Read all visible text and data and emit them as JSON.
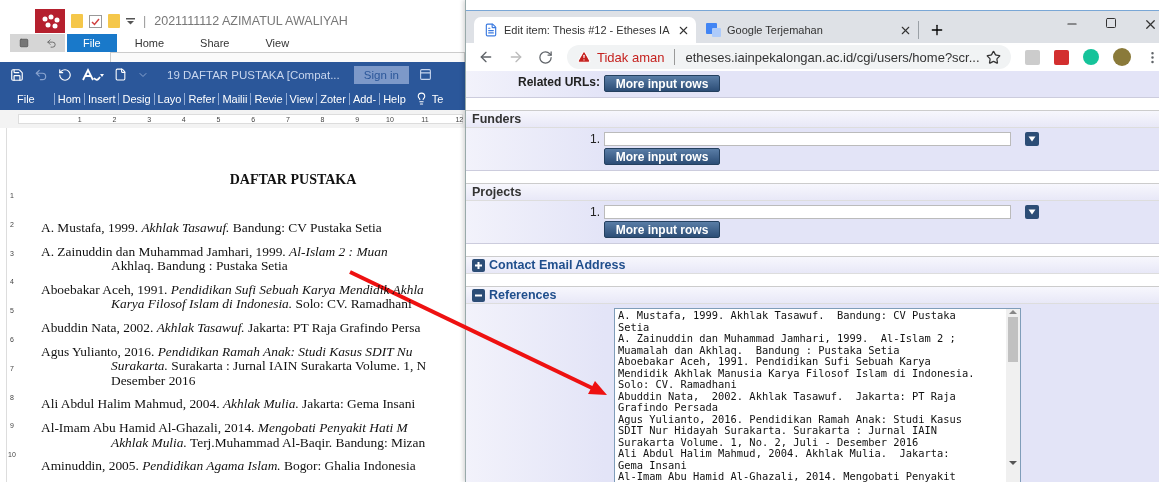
{
  "file_explorer": {
    "separator": "|",
    "title": "2021111112 AZIMATUL AWALIYAH",
    "tabs": [
      {
        "label": "File",
        "selected": true
      },
      {
        "label": "Home",
        "selected": false
      },
      {
        "label": "Share",
        "selected": false
      },
      {
        "label": "View",
        "selected": false
      }
    ]
  },
  "word": {
    "title": "19 DAFTAR PUSTAKA [Compat...",
    "sign_in": "Sign in",
    "tabs": [
      "File",
      "Hom",
      "Insert",
      "Desig",
      "Layo",
      "Refer",
      "Mailii",
      "Revie",
      "View",
      "Zoter",
      "Add-",
      "Help"
    ],
    "tell_me": "Te",
    "ruler_numbers": [
      "1",
      "2",
      "3",
      "4",
      "5",
      "6",
      "7",
      "8",
      "9",
      "10",
      "11",
      "12"
    ],
    "vertical_ruler_numbers": [
      "1",
      "2",
      "3",
      "4",
      "5",
      "6",
      "7",
      "8",
      "9",
      "10"
    ],
    "heading": "DAFTAR PUSTAKA",
    "entries": [
      {
        "lines": [
          "A. Mustafa, 1999. *Akhlak Tasawuf.*  Bandung: CV Pustaka Setia"
        ]
      },
      {
        "lines": [
          "A. Zainuddin dan Muhammad Jamhari, 1999.  *Al-Islam 2 : Muan*",
          "Akhlaq. Bandung : Pustaka Setia"
        ]
      },
      {
        "lines": [
          "Aboebakar Aceh, 1991. *Pendidikan Sufi Sebuah Karya Mendidik Akhla*",
          "*Karya Filosof Islam di Indonesia.*  Solo: CV. Ramadhani"
        ]
      },
      {
        "lines": [
          "Abuddin Nata, 2002. *Akhlak Tasawuf.*  Jakarta: PT Raja Grafindo Persa"
        ]
      },
      {
        "lines": [
          "Agus Yulianto, 2016. *Pendidikan Ramah Anak: Studi Kasus SDIT Nu*",
          "*Surakarta.* Surakarta : Jurnal IAIN Surakarta Volume. 1, N",
          "Desember 2016"
        ]
      },
      {
        "lines": [
          "Ali Abdul Halim Mahmud, 2004. *Akhlak Mulia.*  Jakarta: Gema Insani"
        ]
      },
      {
        "lines": [
          "Al-Imam Abu Hamid Al-Ghazali, 2014. *Mengobati Penyakit Hati M*",
          "*Akhlak Mulia.* Terj.Muhammad Al-Baqir. Bandung: Mizan"
        ]
      },
      {
        "lines": [
          "Aminuddin, 2005. *Pendidikan Agama Islam.*  Bogor: Ghalia Indonesia"
        ]
      }
    ]
  },
  "browser": {
    "tabs": [
      {
        "title": "Edit item: Thesis #12 - Etheses IA",
        "selected": true
      },
      {
        "title": "Google Terjemahan",
        "selected": false
      }
    ],
    "security": "Tidak aman",
    "url": "etheses.iainpekalongan.ac.id/cgi/users/home?scr..."
  },
  "form": {
    "sections": [
      {
        "kind": "cut_row",
        "label": "Related URLs:",
        "button": "More input rows"
      },
      {
        "kind": "multi_input",
        "title": "Funders",
        "row_number": "1.",
        "button": "More input rows"
      },
      {
        "kind": "multi_input",
        "title": "Projects",
        "row_number": "1.",
        "button": "More input rows"
      },
      {
        "kind": "collapsible",
        "title": "Contact Email Address",
        "expanded": false
      },
      {
        "kind": "collapsible",
        "title": "References",
        "expanded": true,
        "text_lines": [
          "A. Mustafa, 1999. Akhlak Tasawuf.  Bandung: CV Pustaka",
          "Setia",
          "A. Zainuddin dan Muhammad Jamhari, 1999.  Al-Islam 2 ;",
          "Muamalah dan Akhlaq.  Bandung : Pustaka Setia",
          "Aboebakar Aceh, 1991. Pendidikan Sufi Sebuah Karya",
          "Mendidik Akhlak Manusia Karya Filosof Islam di Indonesia.",
          "Solo: CV. Ramadhani",
          "Abuddin Nata,  2002. Akhlak Tasawuf.  Jakarta: PT Raja",
          "Grafindo Persada",
          "Agus Yulianto, 2016. Pendidikan Ramah Anak: Studi Kasus",
          "SDIT Nur Hidayah Surakarta. Surakarta : Jurnal IAIN",
          "Surakarta Volume. 1, No. 2, Juli - Desember 2016",
          "Ali Abdul Halim Mahmud, 2004. Akhlak Mulia.  Jakarta:",
          "Gema Insani",
          "Al-Imam Abu Hamid Al-Ghazali, 2014. Mengobati Penyakit"
        ]
      }
    ]
  }
}
